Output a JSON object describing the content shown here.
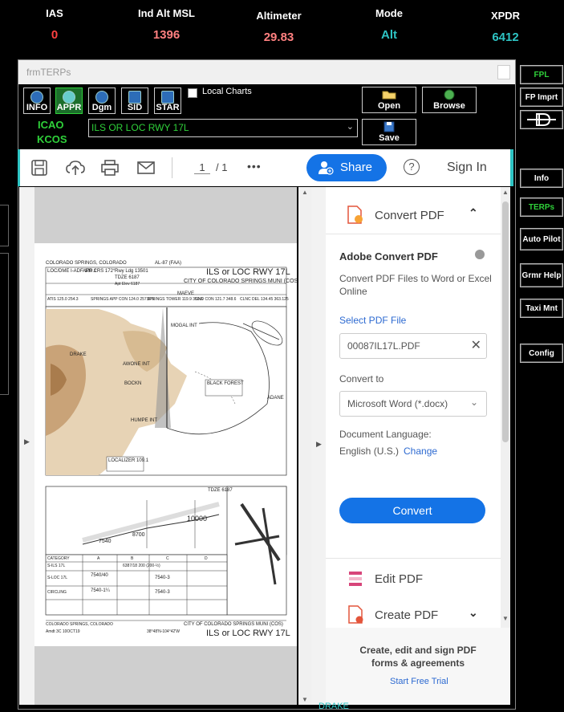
{
  "header": {
    "ias_label": "IAS",
    "ias_value": "0",
    "ind_alt_label": "Ind Alt MSL",
    "ind_alt_value": "1396",
    "altimeter_label": "Altimeter",
    "altimeter_value": "29.83",
    "mode_label": "Mode",
    "mode_value": "Alt",
    "xpdr_label": "XPDR",
    "xpdr_value": "6412",
    "colors": {
      "ias": "#ff4040",
      "alt": "#ff8080",
      "mode": "#2ec4c4",
      "xpdr": "#2ec4c4"
    }
  },
  "right_panel": {
    "fpl": "FPL",
    "fp_imprt": "FP Imprt",
    "info": "Info",
    "terps": "TERPs",
    "auto_pilot": "Auto Pilot",
    "grmr_help": "Grmr Help",
    "taxi_mnt": "Taxi Mnt",
    "config": "Config"
  },
  "window": {
    "title": "frmTERPs",
    "tool_buttons": [
      "INFO",
      "APPR",
      "Dgm",
      "SID",
      "STAR"
    ],
    "local_charts_label": "Local Charts",
    "open_label": "Open",
    "browse_label": "Browse",
    "save_label": "Save",
    "icao_label": "ICAO",
    "icao_value": "KCOS",
    "procedure_value": "ILS OR LOC RWY 17L"
  },
  "pdf": {
    "page_current": "1",
    "page_total": "/ 1",
    "share_label": "Share",
    "sign_in_label": "Sign In",
    "more": "•••",
    "help": "?"
  },
  "convert_panel": {
    "header": "Convert PDF",
    "title": "Adobe Convert PDF",
    "description": "Convert PDF Files to Word or Excel Online",
    "select_file_label": "Select PDF File",
    "file_name": "00087IL17L.PDF",
    "convert_to_label": "Convert to",
    "convert_to_value": "Microsoft Word (*.docx)",
    "doc_language_label": "Document Language:",
    "doc_language_value": "English (U.S.)",
    "change_label": "Change",
    "convert_button": "Convert",
    "edit_pdf": "Edit PDF",
    "create_pdf": "Create PDF",
    "promo_text": "Create, edit and sign PDF forms & agreements",
    "start_trial": "Start Free Trial"
  },
  "approach_chart": {
    "city": "COLORADO SPRINGS, COLORADO",
    "chart_id": "AL-87 (FAA)",
    "procedure": "ILS or LOC RWY 17L",
    "airport": "CITY OF COLORADO SPRINGS MUNI (COS)",
    "loc": "LOC/DME I-ADF 109.1",
    "app_crs": "APP CRS 172°",
    "rwy_ldg": "Rwy Ldg 13501",
    "tdze": "TDZE 6187",
    "apt_elev": "Apt Elev 6187",
    "atis": "ATIS 125.0 254.3",
    "app_con": "SPRINGS APP CON 124.0 257.875",
    "tower": "SPRINGS TOWER 119.9 350.6",
    "gnd": "GND CON 121.7 348.6",
    "clnc": "CLNC DEL 134.45 363.125",
    "fixes": [
      "DRAKE",
      "AWONE INT",
      "BOCKN",
      "HUMPE INT",
      "BLACK FOREST",
      "ADANE",
      "LOCALIZER 109.1",
      "MOGAL INT",
      "MAEVE"
    ],
    "tdze_profile": "TDZE 6187",
    "alt_10000": "10000",
    "alt_8700": "8700",
    "alt_7540": "7540",
    "category": "CATEGORY",
    "cat_a": "A",
    "cat_b": "B",
    "cat_c": "C",
    "cat_d": "D",
    "s_ils": "S-ILS 17L",
    "s_ils_val": "6387/18  200 (200-½)",
    "s_loc": "S-LOC 17L",
    "s_loc_val_a": "7540/40",
    "s_loc_val_c": "7540-3",
    "circling": "CIRCLING",
    "circ_a": "7540-1¼",
    "circ_c": "7540-3",
    "footer_city": "COLORADO SPRINGS, COLORADO",
    "footer_amdt": "Amdt 3C 10OCT19",
    "footer_coords": "38°48'N-104°42'W",
    "footer_airport": "CITY OF COLORADO SPRINGS MUNI (COS)",
    "footer_procedure": "ILS or LOC RWY 17L"
  },
  "bottom": {
    "drake_label": "DRAKE"
  }
}
